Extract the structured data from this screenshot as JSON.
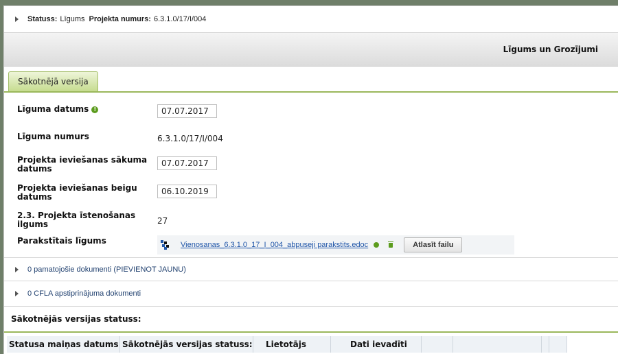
{
  "status_bar": {
    "status_label": "Statuss:",
    "status_value": "Līgums",
    "project_label": "Projekta numurs:",
    "project_value": "6.3.1.0/17/I/004"
  },
  "header": {
    "title": "Līgums un Grozījumi"
  },
  "tabs": [
    {
      "label": "Sākotnējā versija",
      "active": true
    }
  ],
  "form": {
    "contract_date": {
      "label": "Līguma datums",
      "value": "07.07.2017"
    },
    "contract_number": {
      "label": "Līguma numurs",
      "value": "6.3.1.0/17/I/004"
    },
    "start_date": {
      "label": "Projekta ieviešanas sākuma datums",
      "value": "07.07.2017"
    },
    "end_date": {
      "label": "Projekta ieviešanas beigu datums",
      "value": "06.10.2019"
    },
    "duration": {
      "label": "2.3. Projekta īstenošanas ilgums",
      "value": "27"
    },
    "signed_contract": {
      "label": "Parakstītais līgums",
      "file_name": "Vienosanas_6.3.1.0_17_I_004_abpuseji parakstits.edoc",
      "select_button": "Atlasīt failu"
    }
  },
  "sections": {
    "supporting_docs": "0 pamatojošie dokumenti (PIEVIENOT JAUNU)",
    "cfla_docs": "0 CFLA apstiprinājuma dokumenti"
  },
  "version_status": {
    "title": "Sākotnējās versijas statuss:",
    "columns": [
      "Statusa maiņas datums",
      "Sākotnējās versijas statuss:",
      "Lietotājs",
      "Dati ievadīti",
      "",
      "",
      "",
      ""
    ]
  },
  "colors": {
    "accent_green": "#9ab75a",
    "link_blue": "#1f55a8",
    "icon_green": "#5c9c1e"
  }
}
